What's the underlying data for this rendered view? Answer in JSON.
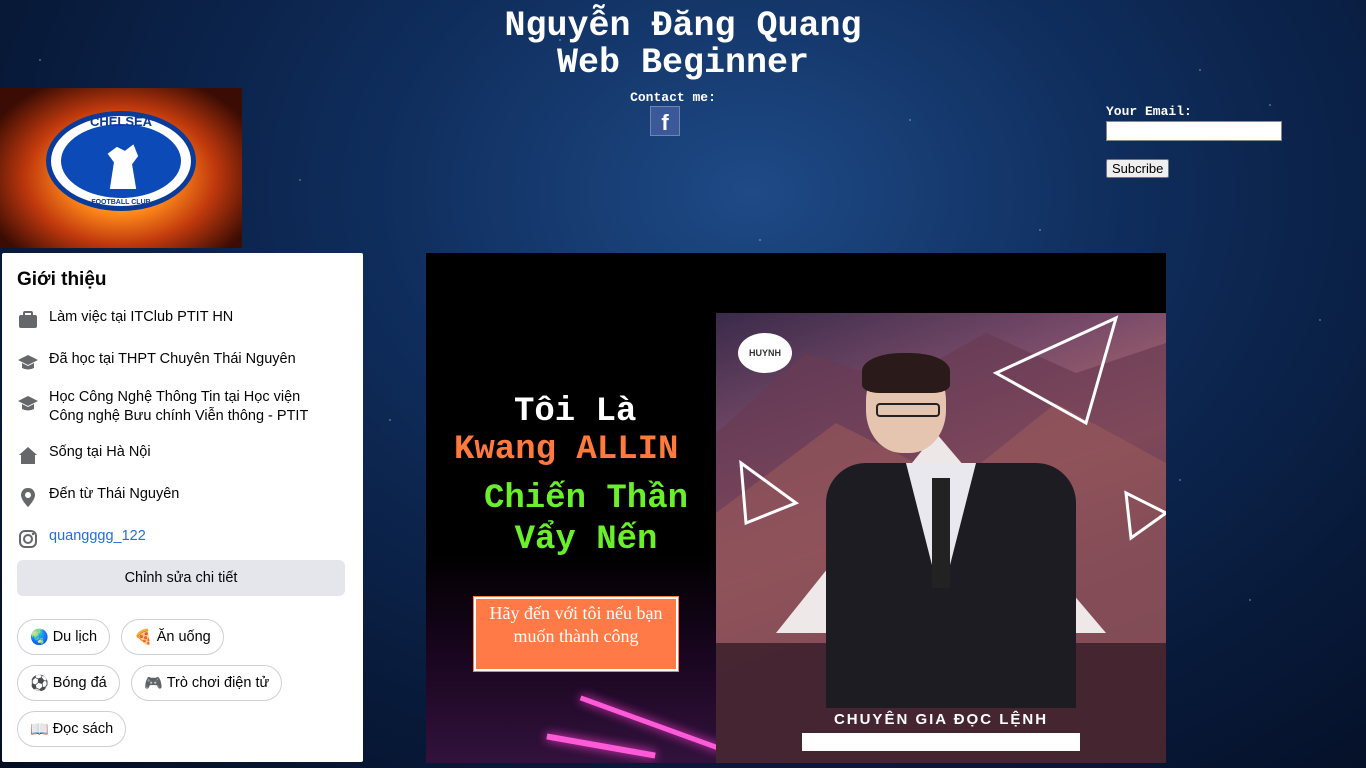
{
  "header": {
    "name": "Nguyễn Đăng Quang",
    "subtitle": "Web Beginner",
    "contact_label": "Contact me:",
    "facebook_glyph": "f"
  },
  "subscribe": {
    "email_label": "Your Email:",
    "email_value": "",
    "button_label": "Subcribe"
  },
  "logo": {
    "top_text": "CHELSEA",
    "bottom_text": "FOOTBALL CLUB"
  },
  "intro": {
    "title": "Giới thiệu",
    "items": [
      {
        "icon": "briefcase-icon",
        "prefix": "Làm việc tại ",
        "value": "ITClub PTIT HN"
      },
      {
        "icon": "graduation-cap-icon",
        "prefix": "Đã học tại ",
        "value": "THPT Chuyên Thái Nguyên"
      },
      {
        "icon": "graduation-cap-icon",
        "prefix": "Học Công Nghệ Thông Tin tại ",
        "value": "Học viện Công nghệ Bưu chính Viễn thông - PTIT"
      },
      {
        "icon": "home-icon",
        "prefix": "Sống tại ",
        "value": "Hà Nội"
      },
      {
        "icon": "location-pin-icon",
        "prefix": "Đến từ ",
        "value": "Thái Nguyên"
      },
      {
        "icon": "instagram-icon",
        "prefix": "",
        "value": "quangggg_122"
      }
    ],
    "edit_button": "Chỉnh sửa chi tiết",
    "hobbies": [
      {
        "emoji": "🌏",
        "label": "Du lịch"
      },
      {
        "emoji": "🍕",
        "label": "Ăn uống"
      },
      {
        "emoji": "⚽",
        "label": "Bóng đá"
      },
      {
        "emoji": "🎮",
        "label": "Trò chơi điện tử"
      },
      {
        "emoji": "📖",
        "label": "Đọc sách"
      }
    ]
  },
  "banner": {
    "line1": "Tôi Là",
    "line2": "Kwang ALLIN",
    "line3": "Chiến Thần Vẩy Nến",
    "cta": "Hãy đến với tôi nếu bạn muốn thành công",
    "poster_logo": "HUYNH",
    "poster_caption": "CHUYÊN GIA ĐỌC LỆNH"
  }
}
